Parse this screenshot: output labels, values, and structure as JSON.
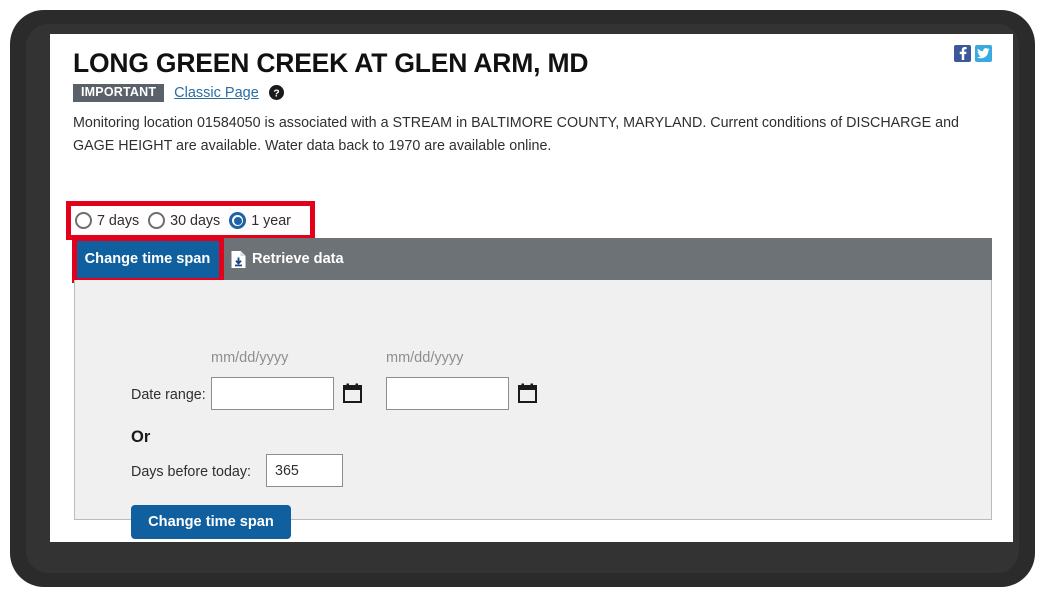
{
  "header": {
    "title": "LONG GREEN CREEK AT GLEN ARM, MD",
    "badge": "IMPORTANT",
    "classic_page_link": "Classic Page",
    "help_icon": "help-circle-icon",
    "social": {
      "facebook": "facebook-icon",
      "twitter": "twitter-icon"
    }
  },
  "description": "Monitoring location 01584050 is associated with a STREAM in BALTIMORE COUNTY, MARYLAND. Current conditions of DISCHARGE and GAGE HEIGHT are available. Water data back to 1970 are available online.",
  "time_span_radios": {
    "options": [
      {
        "label": "7 days",
        "selected": false
      },
      {
        "label": "30 days",
        "selected": false
      },
      {
        "label": "1 year",
        "selected": true
      }
    ],
    "selected_value": "1 year"
  },
  "tabs": [
    {
      "label": "Change time span",
      "active": true,
      "icon": null
    },
    {
      "label": "Retrieve data",
      "active": false,
      "icon": "file-download-icon"
    }
  ],
  "form": {
    "date_range_label": "Date range:",
    "start_date": {
      "placeholder": "mm/dd/yyyy",
      "value": "",
      "hint": "mm/dd/yyyy"
    },
    "end_date": {
      "placeholder": "mm/dd/yyyy",
      "value": "",
      "hint": "mm/dd/yyyy"
    },
    "calendar_icon": "calendar-icon",
    "or_label": "Or",
    "days_before_today_label": "Days before today:",
    "days_before_today_value": "365",
    "submit_label": "Change time span"
  },
  "colors": {
    "accent_blue": "#105f9e",
    "highlight_red": "#e2001a",
    "tabbar_gray": "#6d7276",
    "panel_gray": "#f0f0f0",
    "badge_gray": "#5b6169",
    "link_blue": "#2b6ca3"
  }
}
